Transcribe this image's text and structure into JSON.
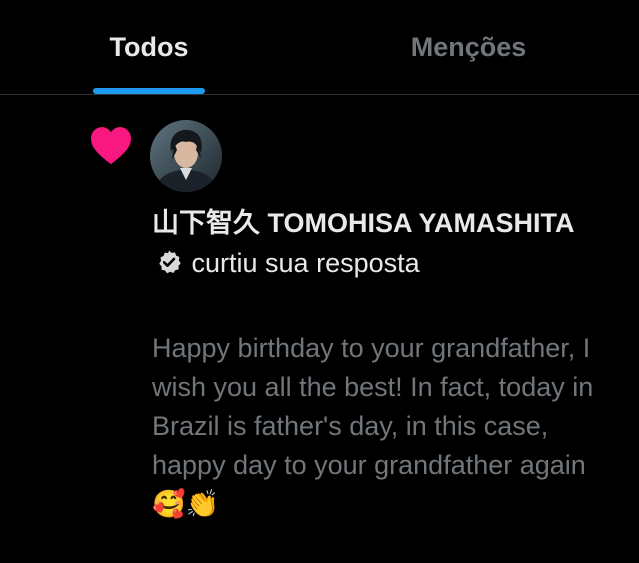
{
  "tabs": [
    {
      "label": "Todos"
    },
    {
      "label": "Menções"
    }
  ],
  "notification": {
    "user_name": "山下智久 TOMOHISA YAMASHITA",
    "action": "curtiu sua resposta",
    "reply_text": "Happy birthday to your grandfather, I wish you all the best! In fact, today in Brazil is father's day, in this case, happy day to your grandfather again 🥰👏",
    "icon": "heart-icon",
    "verified_icon": "verified-badge-icon"
  },
  "colors": {
    "background": "#000000",
    "accent": "#1d9bf0",
    "heart": "#f91880",
    "text_primary": "#e7e9ea",
    "text_secondary": "#71767b"
  }
}
